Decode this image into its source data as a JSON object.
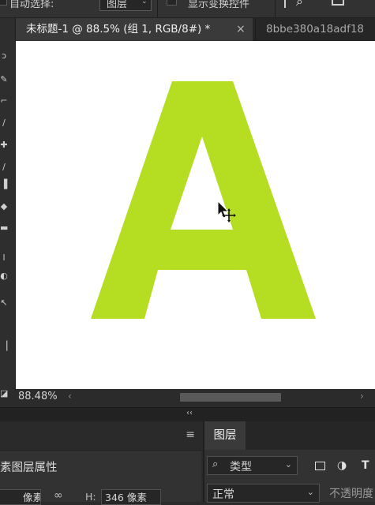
{
  "options_bar": {
    "auto_select_label": "自动选择:",
    "auto_select_value": "图层",
    "show_transform_label": "显示变换控件"
  },
  "document_tabs": [
    {
      "label": "未标题-1 @ 88.5% (组 1, RGB/8#) *",
      "close": "×",
      "active": true
    },
    {
      "label": "8bbe380a18adf18",
      "active": false
    }
  ],
  "canvas": {
    "background_color": "#ffffff",
    "letter": "A",
    "letter_color": "#b5dd22"
  },
  "status_bar": {
    "zoom": "88.48%",
    "scroll_left": "‹",
    "scroll_right": "›"
  },
  "collapse_arrows": "‹‹",
  "properties_panel": {
    "menu_icon": "≡",
    "title": "素图层属性",
    "w_value": "像素",
    "link_icon": "∞",
    "h_label": "H:",
    "h_value": "346 像素"
  },
  "layers_panel": {
    "tab_label": "图层",
    "filter_search_icon": "⌕",
    "filter_label": "类型",
    "filter_icons": [
      "image-icon",
      "adjustment-icon",
      "type-icon"
    ],
    "type_icon_glyph": "T",
    "blend_mode": "正常",
    "opacity_label": "不透明度"
  }
}
